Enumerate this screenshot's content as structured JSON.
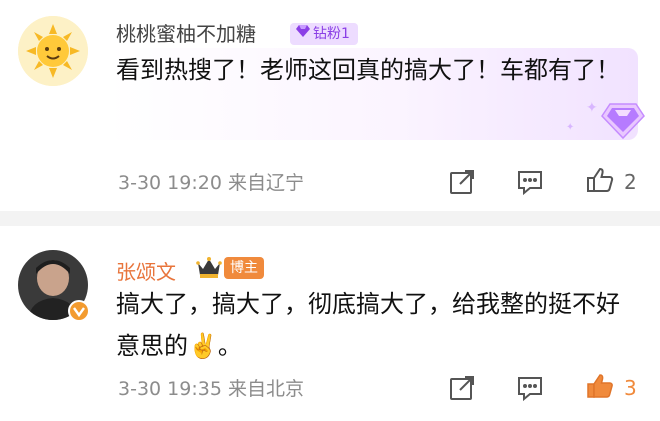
{
  "comments": [
    {
      "username": "桃桃蜜柚不加糖",
      "fan_badge": "钻粉1",
      "text": "看到热搜了！老师这回真的搞大了！车都有了！",
      "meta": "3-30 19:20  来自辽宁",
      "like_count": "2"
    },
    {
      "username": "张颂文",
      "role_badge": "博主",
      "text": "搞大了，搞大了，彻底搞大了，给我整的挺不好意思的✌️。",
      "meta": "3-30 19:35  来自北京",
      "like_count": "3"
    }
  ],
  "colors": {
    "author_name": "#e8743b",
    "fan_badge_bg": "#eddcff",
    "fan_badge_text": "#8b3fe6",
    "blogger_badge_bg": "#f08a3c",
    "liked": "#f08a3c",
    "meta": "#8c8c8c"
  },
  "icons": [
    "sun-avatar",
    "diamond-icon",
    "share-icon",
    "comment-icon",
    "like-icon",
    "crown-icon",
    "verified-icon"
  ]
}
